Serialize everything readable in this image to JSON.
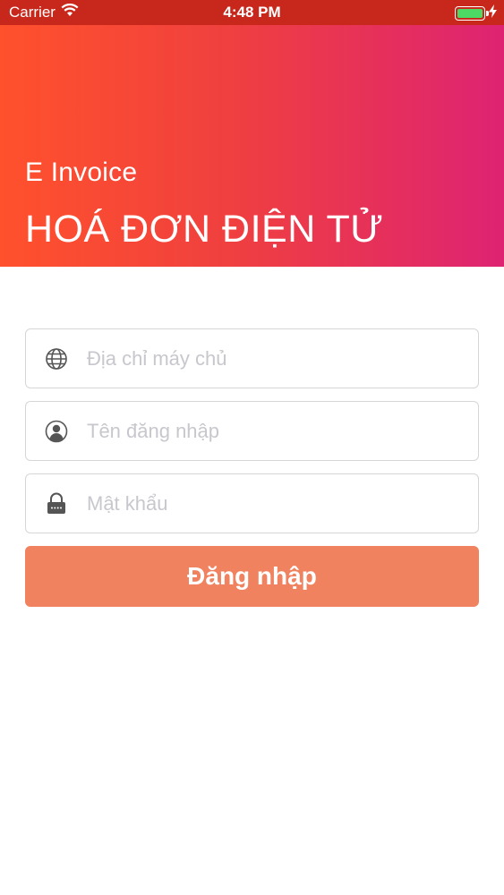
{
  "status_bar": {
    "carrier": "Carrier",
    "time": "4:48 PM",
    "battery_level": 1.0
  },
  "header": {
    "subtitle": "E Invoice",
    "title": "HOÁ ĐƠN ĐIỆN TỬ"
  },
  "form": {
    "server": {
      "placeholder": "Địa chỉ máy chủ",
      "value": "",
      "icon": "globe-icon"
    },
    "username": {
      "placeholder": "Tên đăng nhập",
      "value": "",
      "icon": "user-icon"
    },
    "password": {
      "placeholder": "Mật khẩu",
      "value": "",
      "icon": "lock-icon"
    },
    "login_label": "Đăng nhập"
  },
  "colors": {
    "status_bar": "#c8281c",
    "gradient_start": "#ff512c",
    "gradient_end": "#de2372",
    "button": "#f0825f",
    "battery": "#4cd964"
  }
}
